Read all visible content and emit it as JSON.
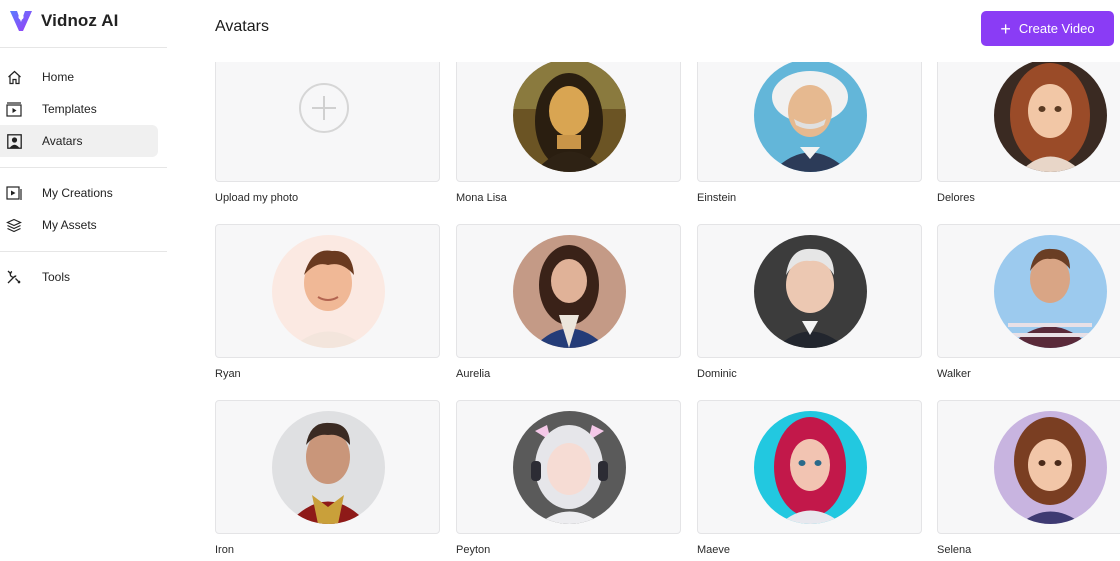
{
  "brand": {
    "name": "Vidnoz AI",
    "accent": "#8a3cf5"
  },
  "sidebar": {
    "items": [
      {
        "label": "Home",
        "icon": "home-icon",
        "active": false
      },
      {
        "label": "Templates",
        "icon": "templates-icon",
        "active": false
      },
      {
        "label": "Avatars",
        "icon": "avatar-icon",
        "active": true
      },
      {
        "label": "My Creations",
        "icon": "play-folder-icon",
        "active": false
      },
      {
        "label": "My Assets",
        "icon": "layers-icon",
        "active": false
      },
      {
        "label": "Tools",
        "icon": "tools-icon",
        "active": false
      }
    ]
  },
  "header": {
    "title": "Avatars",
    "create_label": "Create Video"
  },
  "avatars": [
    {
      "name": "Upload my photo",
      "type": "upload"
    },
    {
      "name": "Mona Lisa"
    },
    {
      "name": "Einstein"
    },
    {
      "name": "Delores"
    },
    {
      "name": "Ryan"
    },
    {
      "name": "Aurelia"
    },
    {
      "name": "Dominic"
    },
    {
      "name": "Walker"
    },
    {
      "name": "Iron"
    },
    {
      "name": "Peyton"
    },
    {
      "name": "Maeve"
    },
    {
      "name": "Selena"
    }
  ]
}
